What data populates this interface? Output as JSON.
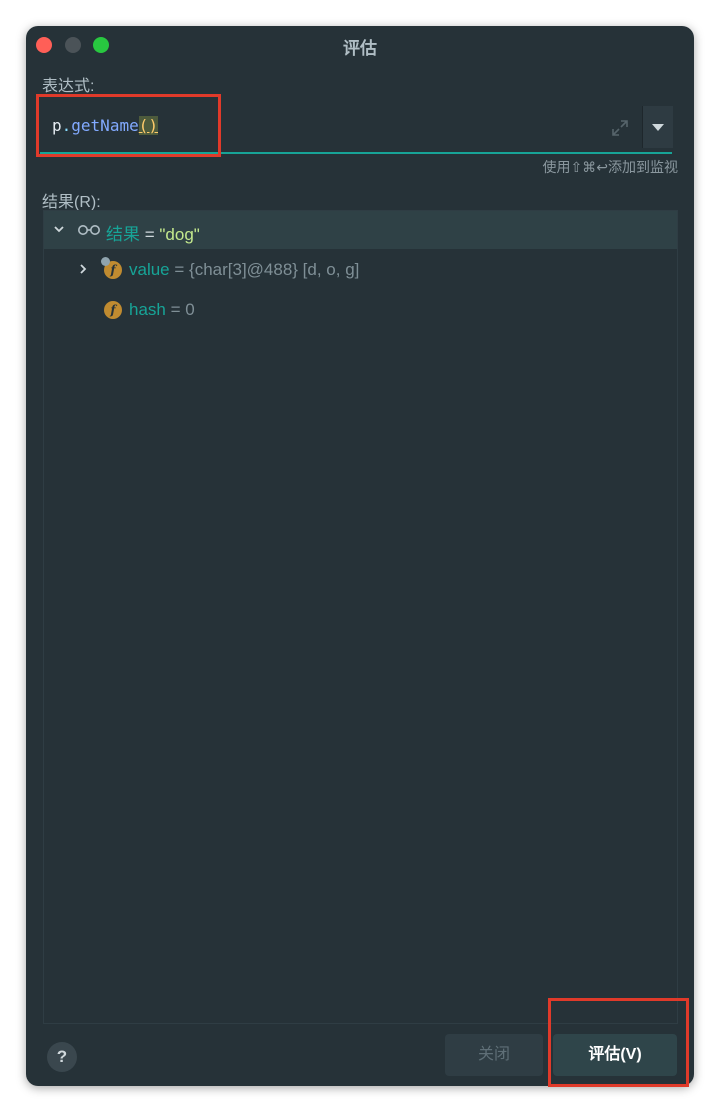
{
  "window": {
    "title": "评估"
  },
  "expression": {
    "label": "表达式:",
    "tokens": {
      "var": "p",
      "dot": ".",
      "method": "getName",
      "paren": "()"
    },
    "hint": "使用⇧⌘↩添加到监视"
  },
  "result": {
    "label": "结果(R):",
    "root": {
      "name": "结果",
      "eq": " = ",
      "value": "\"dog\""
    },
    "children": [
      {
        "name": "value",
        "eq": " = ",
        "value": "{char[3]@488} [d, o, g]"
      },
      {
        "name": "hash",
        "eq": " = ",
        "value": "0"
      }
    ]
  },
  "footer": {
    "help": "?",
    "close_label": "关闭",
    "evaluate_label": "评估(V)"
  },
  "colors": {
    "background": "#263238",
    "accent": "#17a497",
    "annotation": "#e03a2a",
    "field_icon": "#c08b30"
  }
}
